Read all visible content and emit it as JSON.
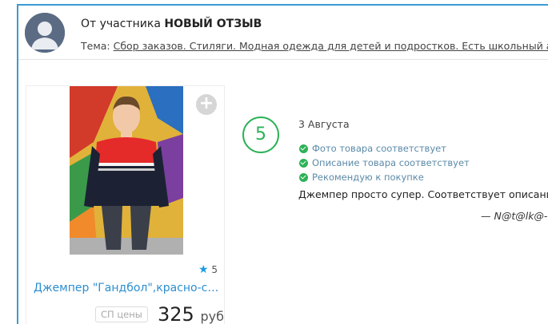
{
  "header": {
    "from_prefix": "От участника",
    "from_name": "НОВЫЙ ОТЗЫВ",
    "topic_label": "Тема:",
    "topic_link": "Сбор заказов. Стиляги. Модная одежда для детей и подростков. Есть школьный ассор"
  },
  "product": {
    "plus_symbol": "+",
    "rating": "5",
    "title": "Джемпер \"Гандбол\",красно-синий",
    "price_label": "СП цены",
    "price": "325",
    "currency": "руб"
  },
  "review": {
    "score": "5",
    "date": "3 Августа",
    "checks": [
      "Фото товара соответствует",
      "Описание товара соответствует",
      "Рекомендую к покупке"
    ],
    "text": "Джемпер просто супер. Соответствует описанию.",
    "author": "— N@t@lk@-..."
  },
  "colors": {
    "accent_blue": "#3a9bd4",
    "link_blue": "#2b8ed1",
    "score_green": "#2cb257",
    "avatar_bg": "#5b6b84"
  }
}
